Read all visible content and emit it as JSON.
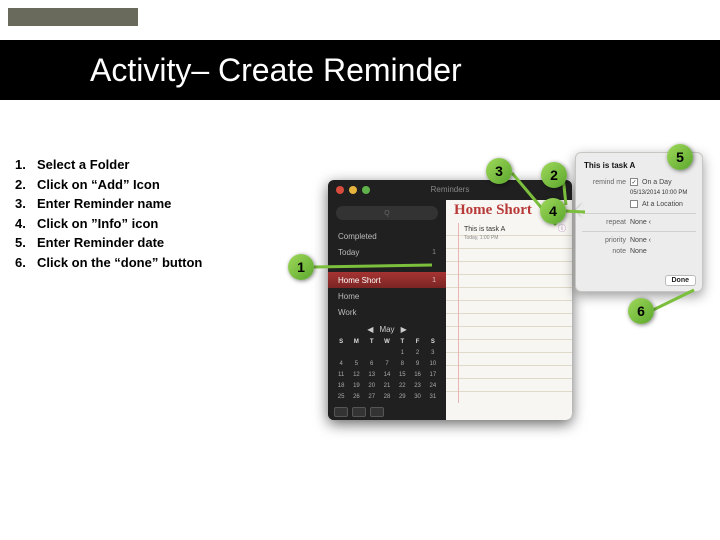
{
  "slide": {
    "title": "Activity– Create Reminder",
    "steps": [
      {
        "num": "1.",
        "text": "Select a Folder"
      },
      {
        "num": "2.",
        "text": "Click on “Add” Icon"
      },
      {
        "num": "3.",
        "text": "Enter Reminder name"
      },
      {
        "num": "4.",
        "text": "Click on ”Info” icon"
      },
      {
        "num": "5.",
        "text": "Enter Reminder date"
      },
      {
        "num": "6.",
        "text": "Click on the “done” button"
      }
    ],
    "badges": [
      "1",
      "2",
      "3",
      "4",
      "5",
      "6"
    ]
  },
  "app": {
    "title": "Reminders",
    "search_placeholder": "Q",
    "folders": [
      {
        "label": "Completed",
        "count": ""
      },
      {
        "label": "Today",
        "count": "1"
      },
      {
        "label": "Home Short",
        "count": "1"
      },
      {
        "label": "Home",
        "count": ""
      },
      {
        "label": "Work",
        "count": ""
      }
    ],
    "add_icon": "+",
    "list": {
      "title": "Home Short",
      "task_text": "This is task A",
      "task_date": "Today, 1:00 PM",
      "info_icon": "ⓘ"
    },
    "calendar": {
      "month": "May",
      "dow": [
        "S",
        "M",
        "T",
        "W",
        "T",
        "F",
        "S"
      ],
      "days": [
        "",
        "",
        "",
        "",
        "1",
        "2",
        "3",
        "4",
        "5",
        "6",
        "7",
        "8",
        "9",
        "10",
        "11",
        "12",
        "13",
        "14",
        "15",
        "16",
        "17",
        "18",
        "19",
        "20",
        "21",
        "22",
        "23",
        "24",
        "25",
        "26",
        "27",
        "28",
        "29",
        "30",
        "31"
      ]
    }
  },
  "popover": {
    "title": "This is task A",
    "remind_label": "remind me",
    "on_day_label": "On a Day",
    "on_day_checked": "✓",
    "date_value": "05/13/2014 10:00 PM",
    "at_loc_label": "At a Location",
    "repeat_label": "repeat",
    "priority_label": "priority",
    "none_value": "None ‹",
    "note_label": "note",
    "note_value": "None",
    "done_label": "Done"
  }
}
